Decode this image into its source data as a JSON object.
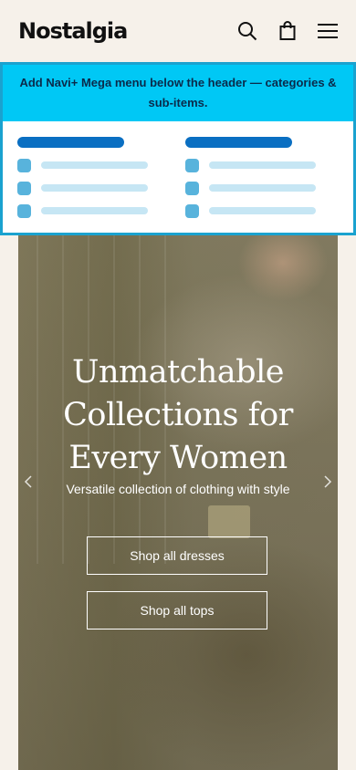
{
  "header": {
    "logo": "Nostalgia",
    "icons": [
      "search-icon",
      "bag-icon",
      "menu-icon"
    ]
  },
  "mega_menu": {
    "banner_text": "Add Navi+ Mega menu below the header — categories & sub-items.",
    "colors": {
      "banner_bg": "#00c8f5",
      "border": "#1aa2cf",
      "heading": "#0a6fc2",
      "square": "#58b3dc",
      "bar": "#c6e6f4"
    }
  },
  "hero": {
    "title_lines": [
      "Unmatchable",
      "Collections for",
      "Every Women"
    ],
    "subtitle": "Versatile collection of clothing with style",
    "buttons": {
      "dresses": "Shop all dresses",
      "tops": "Shop all tops"
    }
  }
}
